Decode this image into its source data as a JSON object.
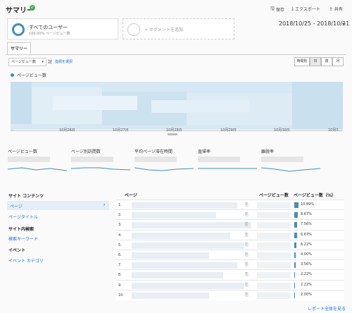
{
  "header": {
    "title": "サマリー",
    "save": "保存",
    "export": "エクスポート",
    "share": "共有"
  },
  "segments": {
    "active_title": "すべてのユーザー",
    "active_sub": "100.00% ページビュー数",
    "add_label": "+ セグメントを追加"
  },
  "date_range": "2018/10/25 - 2018/10/31",
  "tabs": [
    "サマリー"
  ],
  "chart_controls": {
    "metric": "ページビュー数",
    "vs": "対",
    "select_metric": "指標を選択",
    "granularity": [
      "時間別",
      "日",
      "週",
      "月"
    ],
    "active_granularity": "日"
  },
  "legend": "ページビュー数",
  "chart_data": {
    "type": "area",
    "x": [
      "10月26日",
      "10月27日",
      "10月28日",
      "10月29日",
      "10月30日",
      "10月3…"
    ],
    "series": [
      {
        "name": "ページビュー数",
        "values": []
      }
    ]
  },
  "sparklines": [
    "ページビュー数",
    "ページ別訪問数",
    "平均ページ滞在時間",
    "直帰率",
    "離脱率"
  ],
  "sidebar": {
    "site_content": "サイト コンテンツ",
    "page": "ページ",
    "page_title": "ページタイトル",
    "site_search": "サイト内検索",
    "search_keyword": "検索キーワード",
    "events": "イベント",
    "event_category": "イベント カテゴリ"
  },
  "table": {
    "col_page": "ページ",
    "col_pv": "ページビュー数",
    "col_pv_pct": "ページビュー数（%）",
    "rows": [
      {
        "n": "1.",
        "pct": "10.89%",
        "frac": 0.1089
      },
      {
        "n": "2.",
        "pct": "8.67%",
        "frac": 0.0867
      },
      {
        "n": "3.",
        "pct": "7.56%",
        "frac": 0.0756
      },
      {
        "n": "4.",
        "pct": "6.67%",
        "frac": 0.0667
      },
      {
        "n": "5.",
        "pct": "6.22%",
        "frac": 0.0622
      },
      {
        "n": "6.",
        "pct": "4.00%",
        "frac": 0.04
      },
      {
        "n": "7.",
        "pct": "3.56%",
        "frac": 0.0356
      },
      {
        "n": "8.",
        "pct": "2.22%",
        "frac": 0.0222
      },
      {
        "n": "9.",
        "pct": "2.22%",
        "frac": 0.0222
      },
      {
        "n": "10.",
        "pct": "2.00%",
        "frac": 0.02
      }
    ]
  },
  "footer_link": "レポート全体を見る"
}
